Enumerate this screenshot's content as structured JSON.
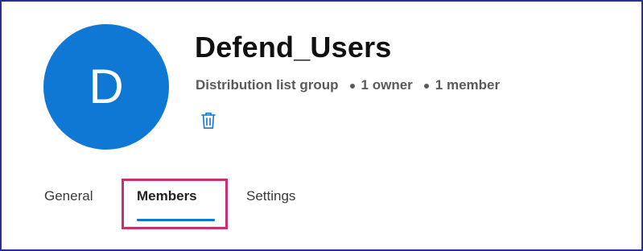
{
  "group": {
    "initial": "D",
    "name": "Defend_Users",
    "type": "Distribution list group",
    "owners": "1 owner",
    "members": "1 member"
  },
  "actions": {
    "delete_icon": "trash-icon"
  },
  "tabs": [
    {
      "label": "General",
      "active": false
    },
    {
      "label": "Members",
      "active": true
    },
    {
      "label": "Settings",
      "active": false
    }
  ],
  "colors": {
    "accent": "#0f78d4",
    "highlight": "#c8306e",
    "frame": "#2b2f8f"
  }
}
